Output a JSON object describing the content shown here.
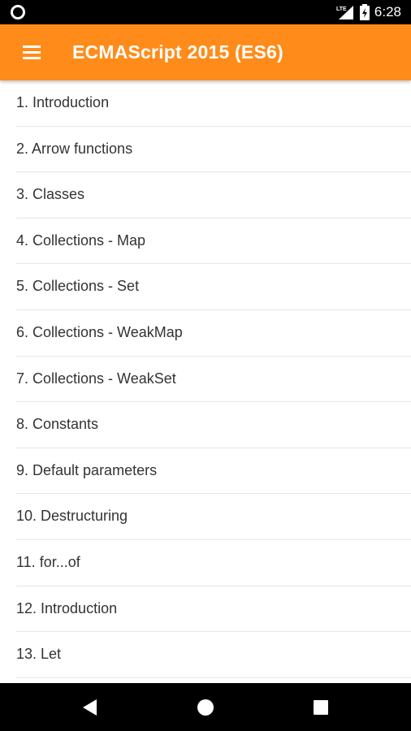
{
  "status_bar": {
    "network_label": "LTE",
    "time": "6:28",
    "icons": [
      "notification-circle-icon",
      "signal-icon",
      "battery-icon"
    ]
  },
  "app_bar": {
    "title": "ECMAScript 2015 (ES6)",
    "menu_icon": "hamburger-menu-icon",
    "background_color": "#ff8c1a"
  },
  "list": {
    "items": [
      {
        "label": "1. Introduction"
      },
      {
        "label": "2. Arrow functions"
      },
      {
        "label": "3. Classes"
      },
      {
        "label": "4. Collections - Map"
      },
      {
        "label": "5. Collections - Set"
      },
      {
        "label": "6. Collections - WeakMap"
      },
      {
        "label": "7. Collections - WeakSet"
      },
      {
        "label": "8. Constants"
      },
      {
        "label": "9. Default parameters"
      },
      {
        "label": "10. Destructuring"
      },
      {
        "label": "11. for...of"
      },
      {
        "label": "12. Introduction"
      },
      {
        "label": "13. Let"
      }
    ]
  },
  "nav_bar": {
    "icons": [
      "back-icon",
      "home-icon",
      "recents-icon"
    ]
  }
}
